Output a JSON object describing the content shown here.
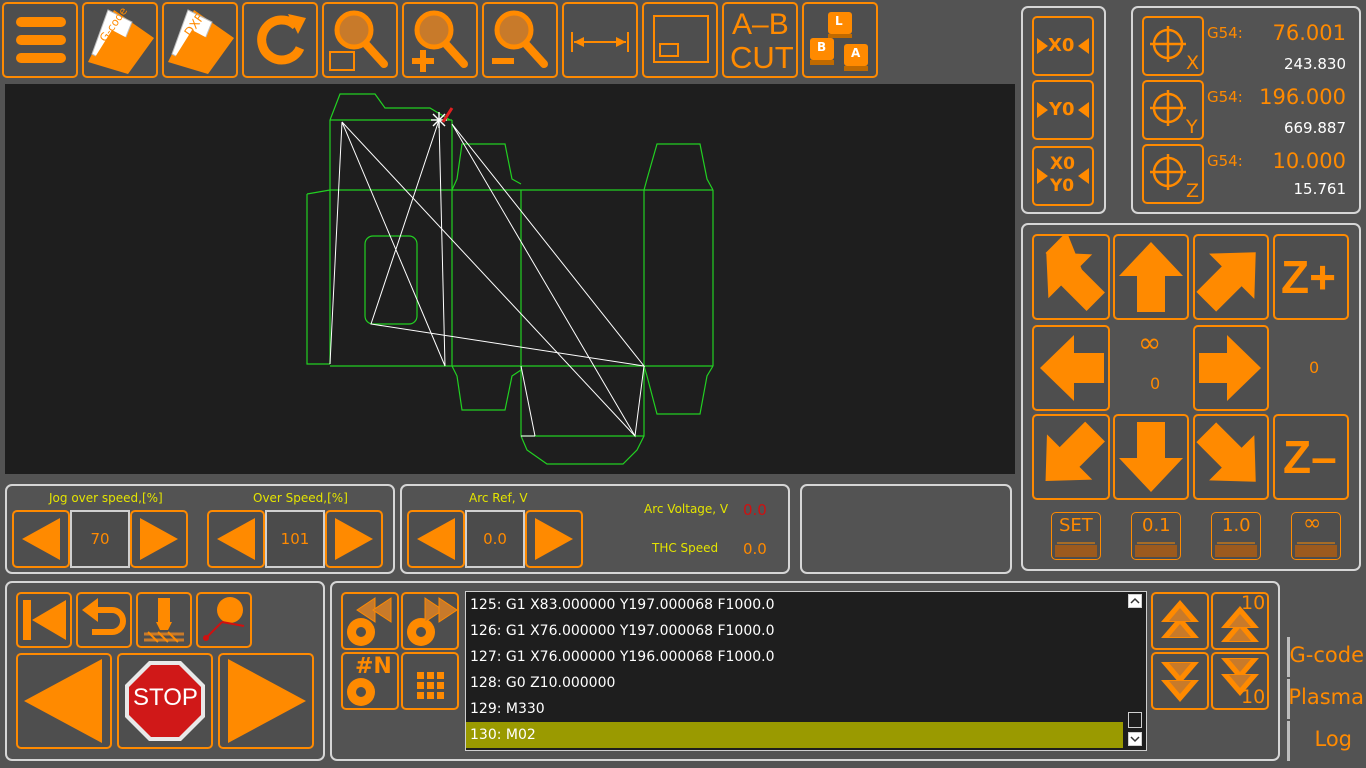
{
  "toolbar": {
    "gcode_label": "G-code",
    "dxf_label": "DXF",
    "abcut_line1": "A–B",
    "abcut_line2": "CUT",
    "keys": [
      "L",
      "B",
      "A"
    ]
  },
  "zero_buttons": {
    "x0": "X0",
    "y0": "Y0",
    "xy0_line1": "X0",
    "xy0_line2": "Y0"
  },
  "coords": {
    "x": {
      "axis": "X",
      "wcs": "G54:",
      "work": "76.001",
      "machine": "243.830"
    },
    "y": {
      "axis": "Y",
      "wcs": "G54:",
      "work": "196.000",
      "machine": "669.887"
    },
    "z": {
      "axis": "Z",
      "wcs": "G54:",
      "work": "10.000",
      "machine": "15.761"
    }
  },
  "jog": {
    "z_plus": "Z+",
    "z_minus": "Z–",
    "infinity": "∞",
    "center_value": "0",
    "right_value": "0",
    "steps": [
      "SET",
      "0.1",
      "1.0",
      "∞"
    ]
  },
  "speeds": {
    "jog_over_label": "Jog over speed,[%]",
    "jog_over_value": "70",
    "over_label": "Over Speed,[%]",
    "over_value": "101"
  },
  "arc": {
    "ref_label": "Arc Ref, V",
    "ref_value": "0.0",
    "voltage_label": "Arc Voltage, V",
    "voltage_value": "0.0",
    "thc_label": "THC Speed",
    "thc_value": "0.0"
  },
  "control": {
    "stop_label": "STOP"
  },
  "gcode_nav": {
    "goto_label": "#N"
  },
  "gcode_lines": [
    "125: G1 X83.000000 Y197.000068 F1000.0",
    "126: G1 X76.000000 Y197.000068 F1000.0",
    "127: G1 X76.000000 Y196.000068 F1000.0",
    "128: G0 Z10.000000",
    "129: M330",
    "130: M02"
  ],
  "gcode_selected_index": 5,
  "scroll_step": {
    "up": "10",
    "down": "10"
  },
  "tabs": [
    "G-code",
    "Plasma",
    "Log"
  ],
  "colors": {
    "accent": "#ff8a00",
    "path": "#22d022",
    "rapid": "#ffffff",
    "highlight": "#9a9a00",
    "label": "#e4e400",
    "voltage": "#d01010"
  }
}
